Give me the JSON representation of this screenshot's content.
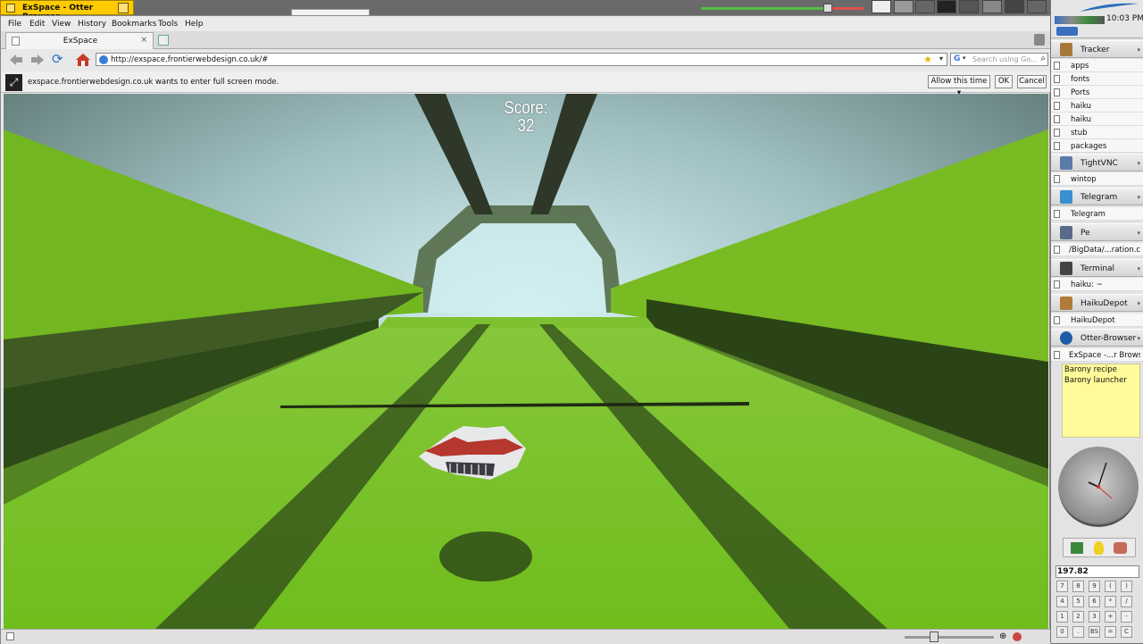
{
  "window": {
    "title": "ExSpace - Otter Browser"
  },
  "menu": [
    "File",
    "Edit",
    "View",
    "History",
    "Bookmarks",
    "Tools",
    "Help"
  ],
  "tab": {
    "label": "ExSpace",
    "close": "×"
  },
  "address": {
    "url": "http://exspace.frontierwebdesign.co.uk/#"
  },
  "search": {
    "engine_icon": "G",
    "placeholder": "Search using Go..."
  },
  "fullscreen": {
    "message": "exspace.frontierwebdesign.co.uk wants to enter full screen mode.",
    "allow_label": "Allow this time",
    "ok_label": "OK",
    "cancel_label": "Cancel"
  },
  "game": {
    "score_label": "Score:",
    "score_value": "32"
  },
  "deskbar": {
    "clock": "10:03 PM",
    "sections": [
      {
        "name": "Tracker",
        "items": [
          "apps",
          "fonts",
          "Ports",
          "haiku",
          "haiku",
          "stub",
          "packages"
        ]
      },
      {
        "name": "TightVNC",
        "items": [
          "wintop"
        ]
      },
      {
        "name": "Telegram",
        "items": [
          "Telegram"
        ]
      },
      {
        "name": "Pe",
        "items": [
          "/BigData/...ration.cpp"
        ]
      },
      {
        "name": "Terminal",
        "items": [
          "haiku: ~"
        ]
      },
      {
        "name": "HaikuDepot",
        "items": [
          "HaikuDepot"
        ]
      },
      {
        "name": "Otter-Browser",
        "items": [
          "ExSpace -...r Browser"
        ]
      }
    ],
    "notes": [
      "Barony recipe",
      "Barony launcher"
    ],
    "calculator": {
      "display": "197.82",
      "keys": [
        [
          "7",
          "8",
          "9",
          "(",
          ")"
        ],
        [
          "4",
          "5",
          "6",
          "*",
          "/"
        ],
        [
          "1",
          "2",
          "3",
          "+",
          "-"
        ],
        [
          "0",
          ".",
          "BS",
          "=",
          "C"
        ]
      ]
    }
  },
  "colors": {
    "title_tab": "#ffcb00",
    "floor": "#7cc42a",
    "notes": "#fffb9a"
  },
  "icons": [
    "back-arrow-icon",
    "forward-arrow-icon",
    "reload-icon",
    "home-icon",
    "bookmark-star-icon",
    "search-icon",
    "fullscreen-icon",
    "trash-icon"
  ]
}
